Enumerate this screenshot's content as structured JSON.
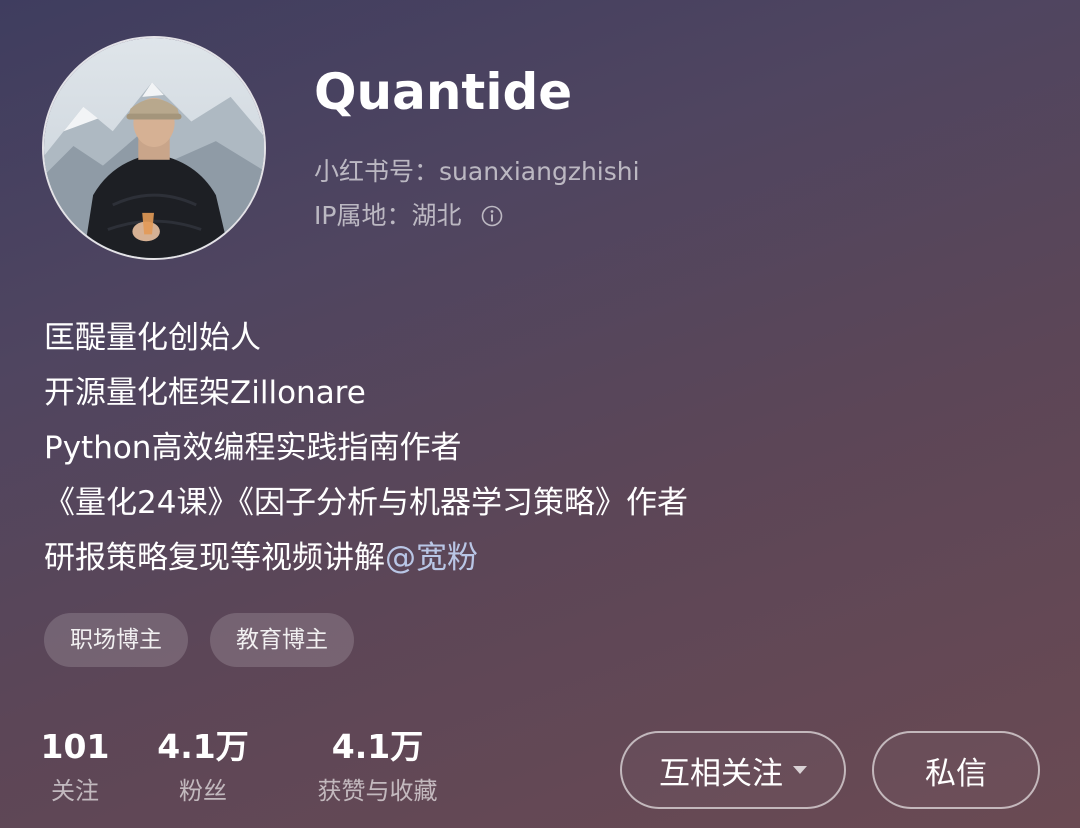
{
  "profile": {
    "nickname": "Quantide",
    "id_label": "小红书号：",
    "id_value": "suanxiangzhishi",
    "ip_label": "IP属地：",
    "ip_value": "湖北",
    "info_icon": "info-circle-icon",
    "avatar_icon": "person-avatar"
  },
  "bio": {
    "line1": "匡醍量化创始人",
    "line2": "开源量化框架Zillonare",
    "line3": "Python高效编程实践指南作者",
    "line4": "《量化24课》《因子分析与机器学习策略》作者",
    "line5_text": "研报策略复现等视频讲解",
    "line5_mention": "@宽粉"
  },
  "tags": [
    "职场博主",
    "教育博主"
  ],
  "stats": {
    "following_value": "101",
    "following_label": "关注",
    "fans_value": "4.1万",
    "fans_label": "粉丝",
    "likes_value": "4.1万",
    "likes_label": "获赞与收藏"
  },
  "actions": {
    "follow_label": "互相关注",
    "message_label": "私信"
  },
  "colors": {
    "background_top": "#3f3d5f",
    "background_bottom": "#6a4a53",
    "mention": "#b9c6e6"
  }
}
